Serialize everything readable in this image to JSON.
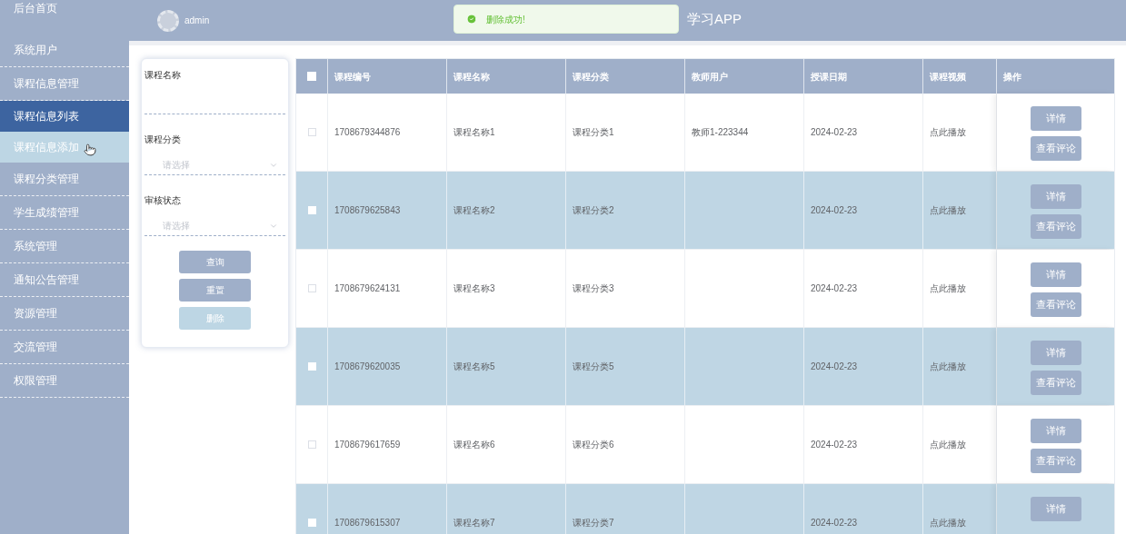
{
  "sidebar": {
    "items": [
      {
        "label": "后台首页",
        "selected": false
      },
      {
        "label": "系统用户",
        "selected": false
      },
      {
        "label": "课程信息管理",
        "selected": false,
        "children": [
          {
            "label": "课程信息列表",
            "selected": true,
            "hovered": false
          },
          {
            "label": "课程信息添加",
            "selected": false,
            "hovered": true
          }
        ]
      },
      {
        "label": "课程分类管理",
        "selected": false
      },
      {
        "label": "学生成绩管理",
        "selected": false
      },
      {
        "label": "系统管理",
        "selected": false
      },
      {
        "label": "通知公告管理",
        "selected": false
      },
      {
        "label": "资源管理",
        "selected": false
      },
      {
        "label": "交流管理",
        "selected": false
      },
      {
        "label": "权限管理",
        "selected": false
      }
    ]
  },
  "header": {
    "user": "admin",
    "title": "学习APP"
  },
  "toast": {
    "message": "删除成功!"
  },
  "filter": {
    "fields": [
      {
        "kind": "input",
        "label": "课程名称"
      },
      {
        "kind": "select",
        "label": "课程分类",
        "placeholder": "请选择"
      },
      {
        "kind": "select",
        "label": "审核状态",
        "placeholder": "请选择"
      }
    ],
    "buttons": [
      {
        "label": "查询",
        "disabled": false
      },
      {
        "label": "重置",
        "disabled": false
      },
      {
        "label": "删除",
        "disabled": true
      }
    ]
  },
  "table": {
    "header_checked": false,
    "columns": [
      "课程编号",
      "课程名称",
      "课程分类",
      "教师用户",
      "授课日期",
      "课程视频",
      "操作"
    ],
    "rows": [
      {
        "checked": false,
        "cells": [
          "1708679344876",
          "课程名称1",
          "课程分类1",
          "教师1-223344",
          "2024-02-23",
          "点此播放"
        ],
        "actions": [
          "详情",
          "查看评论"
        ]
      },
      {
        "checked": false,
        "cells": [
          "1708679625843",
          "课程名称2",
          "课程分类2",
          "",
          "2024-02-23",
          "点此播放"
        ],
        "actions": [
          "详情",
          "查看评论"
        ]
      },
      {
        "checked": false,
        "cells": [
          "1708679624131",
          "课程名称3",
          "课程分类3",
          "",
          "2024-02-23",
          "点此播放"
        ],
        "actions": [
          "详情",
          "查看评论"
        ]
      },
      {
        "checked": false,
        "cells": [
          "1708679620035",
          "课程名称5",
          "课程分类5",
          "",
          "2024-02-23",
          "点此播放"
        ],
        "actions": [
          "详情",
          "查看评论"
        ]
      },
      {
        "checked": false,
        "cells": [
          "1708679617659",
          "课程名称6",
          "课程分类6",
          "",
          "2024-02-23",
          "点此播放"
        ],
        "actions": [
          "详情",
          "查看评论"
        ]
      },
      {
        "checked": false,
        "cells": [
          "1708679615307",
          "课程名称7",
          "课程分类7",
          "",
          "2024-02-23",
          "点此播放"
        ],
        "actions": [
          "详情"
        ]
      }
    ]
  }
}
